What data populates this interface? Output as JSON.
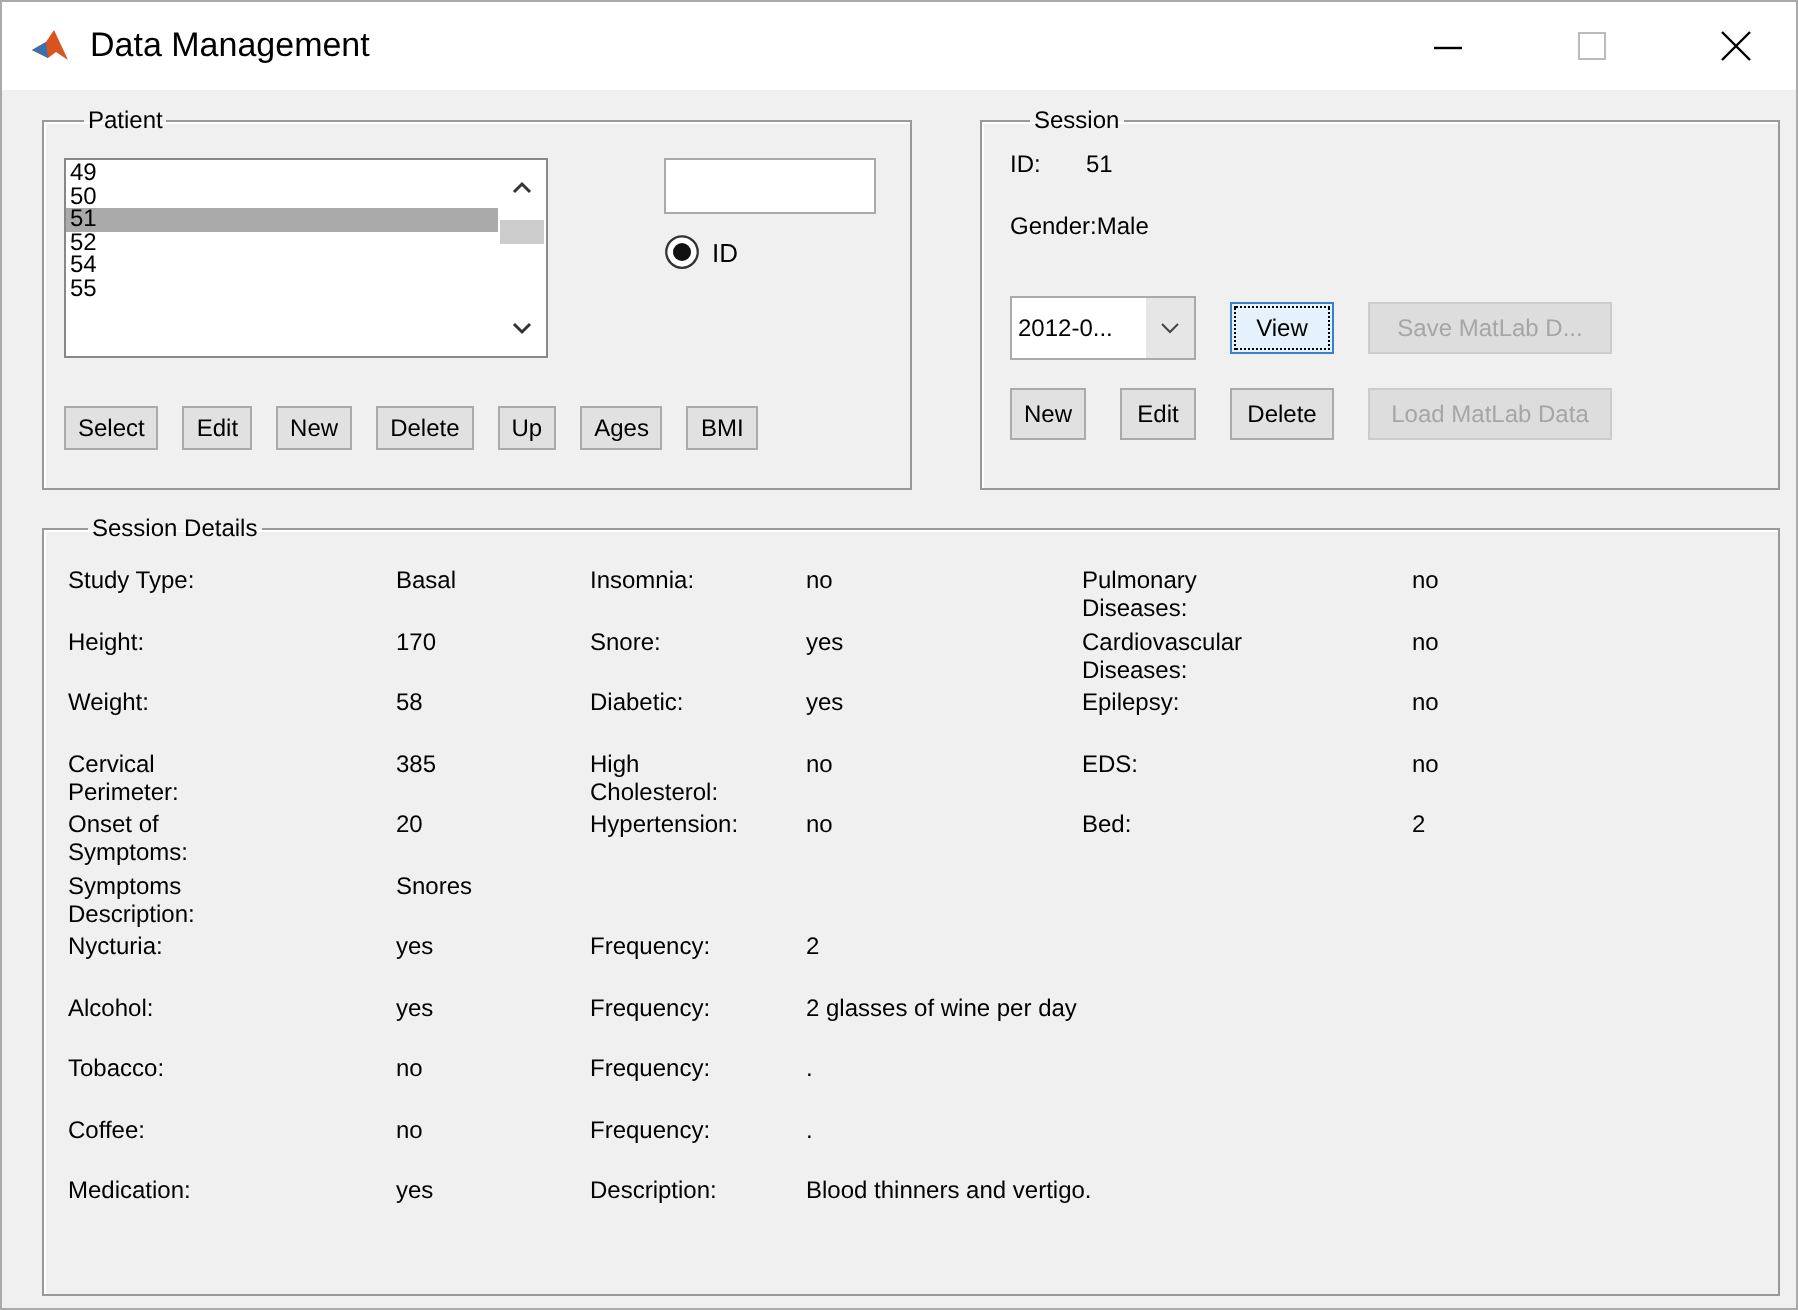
{
  "window": {
    "title": "Data Management"
  },
  "patient": {
    "title": "Patient",
    "list": [
      {
        "label": "49",
        "selected": false
      },
      {
        "label": "50",
        "selected": false
      },
      {
        "label": "51",
        "selected": true
      },
      {
        "label": "52",
        "selected": false
      },
      {
        "label": "54",
        "selected": false
      },
      {
        "label": "55",
        "selected": false
      }
    ],
    "radio": {
      "label": "ID",
      "selected": true
    },
    "buttons": [
      "Select",
      "Edit",
      "New",
      "Delete",
      "Up",
      "Ages",
      "BMI"
    ]
  },
  "session": {
    "title": "Session",
    "id_label": "ID:",
    "id_value": "51",
    "gender_label": "Gender:",
    "gender_value": "Male",
    "date": "2012-0...",
    "buttons": [
      {
        "label": "View",
        "disabled": false,
        "focused": true
      },
      {
        "label": "Save MatLab D...",
        "disabled": true,
        "focused": false
      },
      {
        "label": "New",
        "disabled": false,
        "focused": false
      },
      {
        "label": "Edit",
        "disabled": false,
        "focused": false
      },
      {
        "label": "Delete",
        "disabled": false,
        "focused": false
      },
      {
        "label": "Load MatLab Data",
        "disabled": true,
        "focused": false
      }
    ]
  },
  "details": {
    "title": "Session Details",
    "rows": [
      [
        {
          "label": "Study Type:",
          "value": "Basal"
        },
        {
          "label": "Insomnia:",
          "value": "no"
        },
        {
          "label": "Pulmonary Diseases:",
          "value": "no"
        }
      ],
      [
        {
          "label": "Height:",
          "value": "170"
        },
        {
          "label": "Snore:",
          "value": "yes"
        },
        {
          "label": "Cardiovascular Diseases:",
          "value": "no"
        }
      ],
      [
        {
          "label": "Weight:",
          "value": "58"
        },
        {
          "label": "Diabetic:",
          "value": "yes"
        },
        {
          "label": "Epilepsy:",
          "value": "no"
        }
      ],
      [
        {
          "label": "Cervical Perimeter:",
          "value": "385"
        },
        {
          "label": "High Cholesterol:",
          "value": "no"
        },
        {
          "label": "EDS:",
          "value": "no"
        }
      ],
      [
        {
          "label": "Onset of Symptoms:",
          "value": "20"
        },
        {
          "label": "Hypertension:",
          "value": "no"
        },
        {
          "label": "Bed:",
          "value": "2"
        }
      ],
      [
        {
          "label": "Symptoms Description:",
          "value": "Snores"
        }
      ],
      [
        {
          "label": "Nycturia:",
          "value": "yes"
        },
        {
          "label": "Frequency:",
          "value": "2"
        }
      ],
      [
        {
          "label": "Alcohol:",
          "value": "yes"
        },
        {
          "label": "Frequency:",
          "value": "2 glasses of wine per day"
        }
      ],
      [
        {
          "label": "Tobacco:",
          "value": "no"
        },
        {
          "label": "Frequency:",
          "value": "."
        }
      ],
      [
        {
          "label": "Coffee:",
          "value": "no"
        },
        {
          "label": "Frequency:",
          "value": "."
        }
      ],
      [
        {
          "label": "Medication:",
          "value": "yes"
        },
        {
          "label": "Description:",
          "value": "Blood thinners and vertigo."
        }
      ]
    ]
  }
}
